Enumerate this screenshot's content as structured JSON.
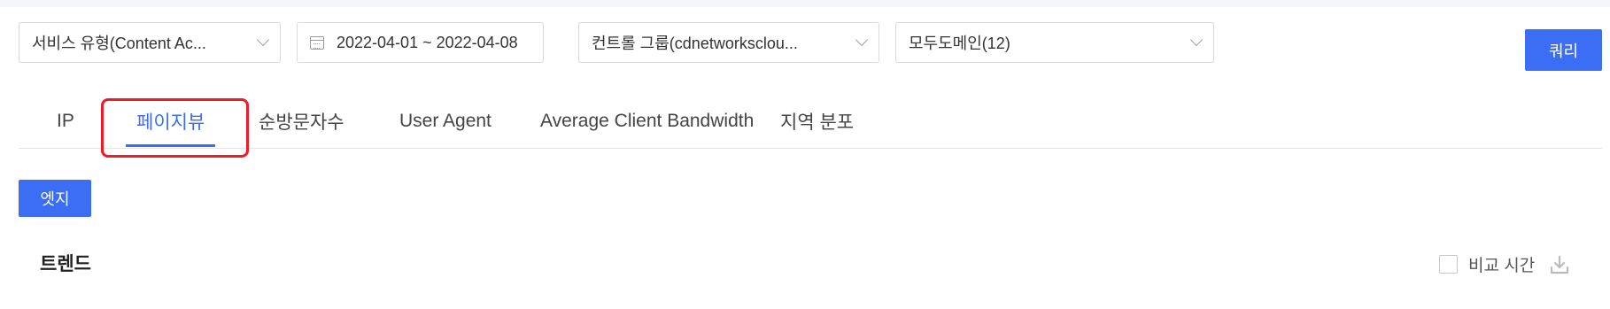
{
  "filters": {
    "service_type": "서비스 유형(Content Ac...",
    "date_range": "2022-04-01 ~ 2022-04-08",
    "control_group": "컨트롤 그룹(cdnetworksclou...",
    "domain": "모두도메인(12)"
  },
  "query_button": "쿼리",
  "tabs": [
    {
      "label": "IP"
    },
    {
      "label": "페이지뷰"
    },
    {
      "label": "순방문자수"
    },
    {
      "label": "User Agent"
    },
    {
      "label": "Average Client Bandwidth"
    },
    {
      "label": "지역 분포"
    }
  ],
  "active_tab": "페이지뷰",
  "edge_button": "엣지",
  "section": {
    "title": "트렌드",
    "compare_label": "비교 시간"
  },
  "colors": {
    "accent": "#3b6ef5",
    "highlight": "#ee1c25"
  },
  "icons": [
    "calendar-icon",
    "chevron-down-icon",
    "download-icon",
    "checkbox"
  ]
}
